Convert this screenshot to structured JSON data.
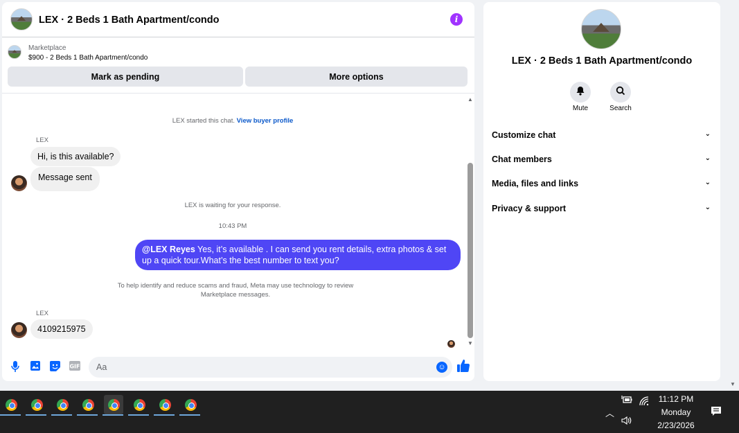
{
  "chat": {
    "title": "LEX · 2 Beds 1 Bath Apartment/condo",
    "listing_label": "Marketplace",
    "listing_price": "$900 - 2 Beds 1 Bath Apartment/condo",
    "mark_pending_label": "Mark as pending",
    "more_options_label": "More options",
    "started_text": "LEX started this chat.",
    "view_profile_link": "View buyer profile",
    "sender_name_1": "LEX",
    "msg_1": "Hi, is this available?",
    "msg_2": "Message sent",
    "waiting_text": "LEX is waiting for your response.",
    "timestamp": "10:43 PM",
    "out_mention": "@LEX Reyes",
    "out_text": " Yes, it’s available .  I can send you rent details, extra photos & set up a quick tour.What’s the best number to text you?",
    "scam_notice": "To help identify and reduce scams and fraud, Meta may use technology to review Marketplace messages.",
    "sender_name_2": "LEX",
    "msg_3": "4109215975",
    "composer_placeholder": "Aa"
  },
  "info": {
    "title": "LEX · 2 Beds 1 Bath Apartment/condo",
    "mute_label": "Mute",
    "search_label": "Search",
    "sections": [
      "Customize chat",
      "Chat members",
      "Media, files and links",
      "Privacy & support"
    ]
  },
  "taskbar": {
    "time": "11:12 PM",
    "day": "Monday",
    "date": "2/23/2026"
  },
  "colors": {
    "accent": "#0866ff",
    "outgoing_bubble": "#4f46f5",
    "info_icon": "#a033ff"
  }
}
